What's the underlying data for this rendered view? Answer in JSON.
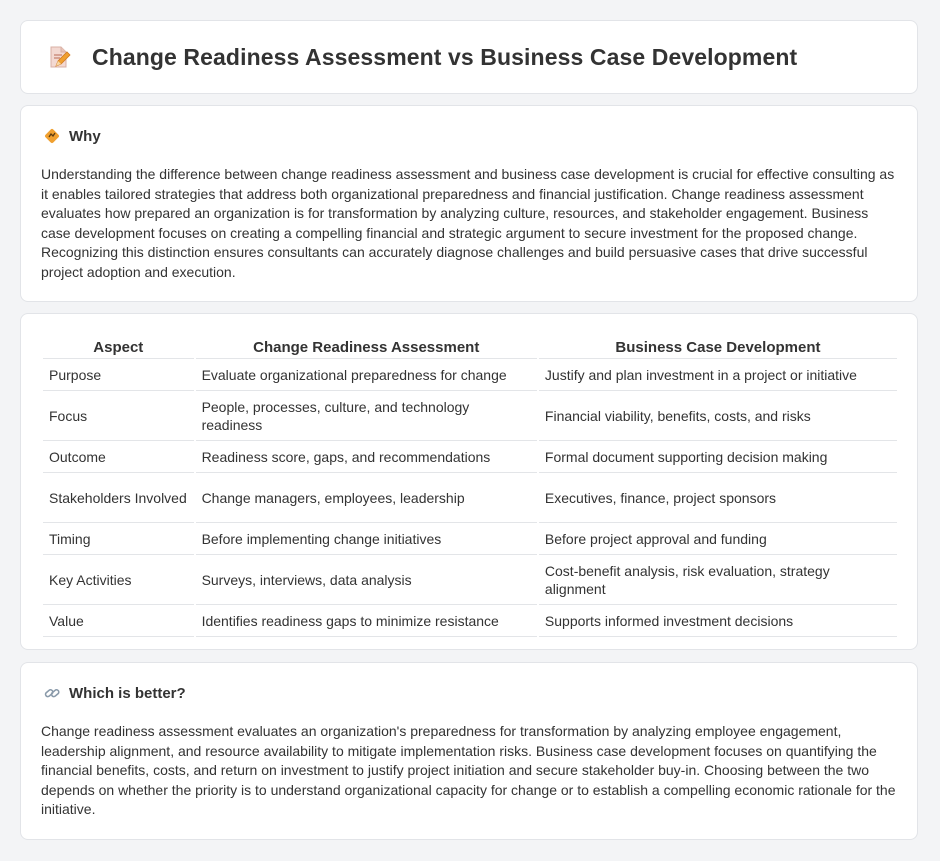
{
  "header": {
    "title": "Change Readiness Assessment vs Business Case Development",
    "icon": "document-edit-icon"
  },
  "why": {
    "icon": "diamond-sign-icon",
    "title": "Why",
    "text": "Understanding the difference between change readiness assessment and business case development is crucial for effective consulting as it enables tailored strategies that address both organizational preparedness and financial justification. Change readiness assessment evaluates how prepared an organization is for transformation by analyzing culture, resources, and stakeholder engagement. Business case development focuses on creating a compelling financial and strategic argument to secure investment for the proposed change. Recognizing this distinction ensures consultants can accurately diagnose challenges and build persuasive cases that drive successful project adoption and execution."
  },
  "table": {
    "headers": [
      "Aspect",
      "Change Readiness Assessment",
      "Business Case Development"
    ],
    "rows": [
      [
        "Purpose",
        "Evaluate organizational preparedness for change",
        "Justify and plan investment in a project or initiative"
      ],
      [
        "Focus",
        "People, processes, culture, and technology readiness",
        "Financial viability, benefits, costs, and risks"
      ],
      [
        "Outcome",
        "Readiness score, gaps, and recommendations",
        "Formal document supporting decision making"
      ],
      [
        "Stakeholders Involved",
        "Change managers, employees, leadership",
        "Executives, finance, project sponsors"
      ],
      [
        "Timing",
        "Before implementing change initiatives",
        "Before project approval and funding"
      ],
      [
        "Key Activities",
        "Surveys, interviews, data analysis",
        "Cost-benefit analysis, risk evaluation, strategy alignment"
      ],
      [
        "Value",
        "Identifies readiness gaps to minimize resistance",
        "Supports informed investment decisions"
      ]
    ]
  },
  "which": {
    "icon": "link-icon",
    "title": "Which is better?",
    "text": "Change readiness assessment evaluates an organization's preparedness for transformation by analyzing employee engagement, leadership alignment, and resource availability to mitigate implementation risks. Business case development focuses on quantifying the financial benefits, costs, and return on investment to justify project initiation and secure stakeholder buy-in. Choosing between the two depends on whether the priority is to understand organizational capacity for change or to establish a compelling economic rationale for the initiative."
  },
  "colors": {
    "background": "#f3f4f6",
    "card": "#ffffff",
    "text": "#333333",
    "border": "#e3e5e8",
    "icon_orange": "#f0a030"
  }
}
